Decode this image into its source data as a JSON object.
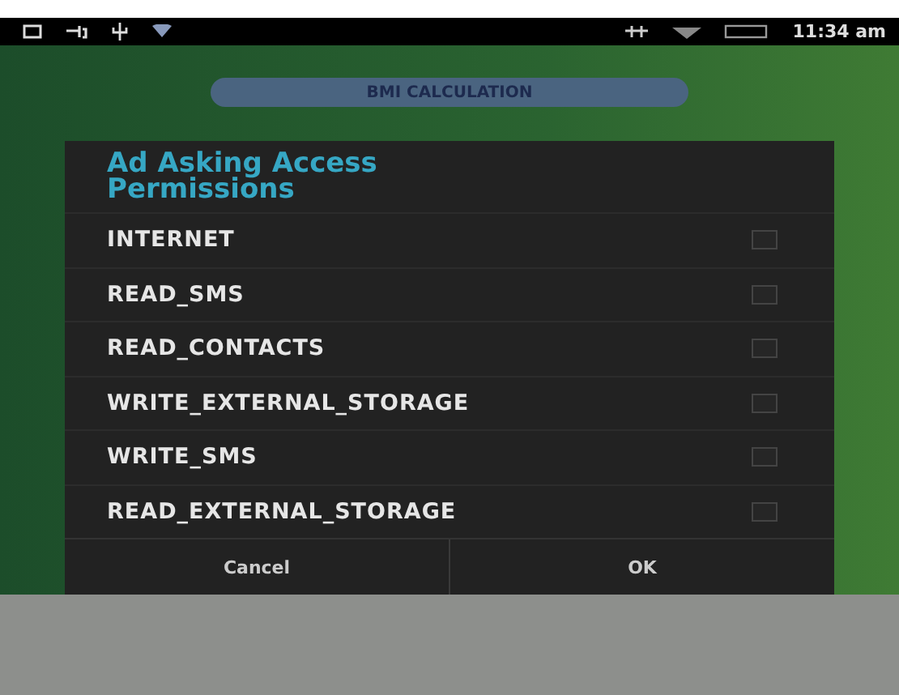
{
  "status_bar": {
    "time": "11:34 am"
  },
  "calc_button": {
    "label": "BMI CALCULATION"
  },
  "dialog": {
    "title": "Ad Asking Access Permissions",
    "permissions": [
      {
        "label": "INTERNET",
        "checked": false
      },
      {
        "label": "READ_SMS",
        "checked": false
      },
      {
        "label": "READ_CONTACTS",
        "checked": false
      },
      {
        "label": "WRITE_EXTERNAL_STORAGE",
        "checked": false
      },
      {
        "label": "WRITE_SMS",
        "checked": false
      },
      {
        "label": "READ_EXTERNAL_STORAGE",
        "checked": false
      }
    ],
    "buttons": [
      "Cancel",
      "OK"
    ]
  }
}
